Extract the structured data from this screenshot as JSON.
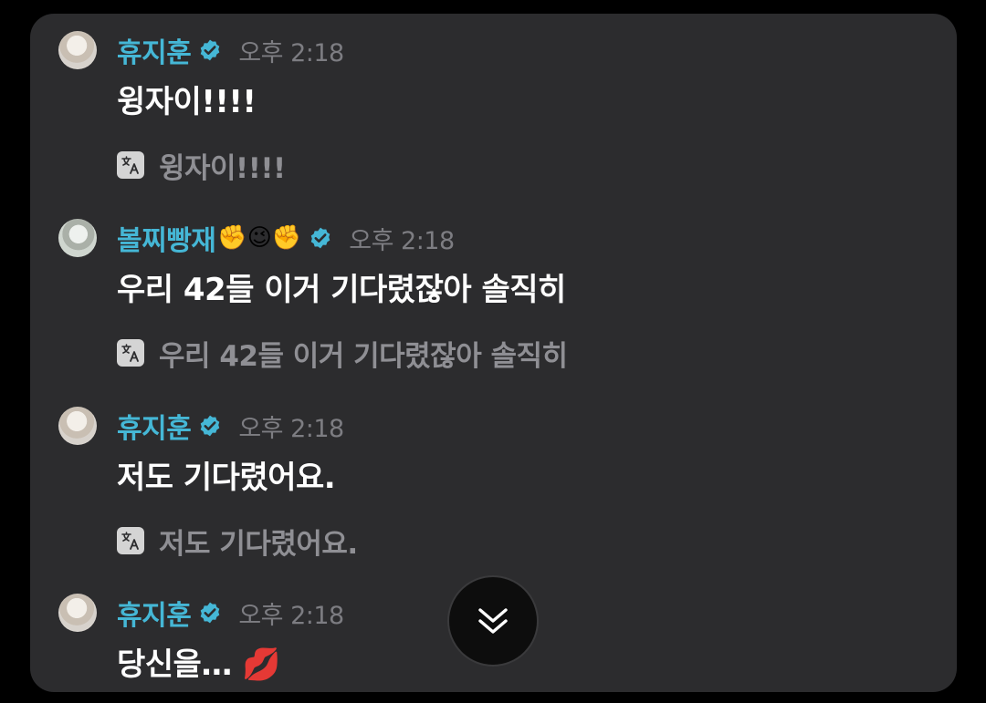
{
  "messages": [
    {
      "author": "휴지훈",
      "author_emojis": "",
      "time": "오후 2:18",
      "text": "윙자이!!!!",
      "translation": "윙자이!!!!"
    },
    {
      "author": "볼찌빵재",
      "author_emojis": "✊😉✊",
      "time": "오후 2:18",
      "text": "우리 42들 이거 기다렸잖아 솔직히",
      "translation": "우리 42들 이거 기다렸잖아 솔직히"
    },
    {
      "author": "휴지훈",
      "author_emojis": "",
      "time": "오후 2:18",
      "text": "저도 기다렸어요.",
      "translation": "저도 기다렸어요."
    },
    {
      "author": "휴지훈",
      "author_emojis": "",
      "time": "오후 2:18",
      "text": "당신을… 💋"
    }
  ],
  "icons": {
    "verified": "verified-badge-icon",
    "translate": "translate-icon",
    "scroll_down": "double-chevron-down-icon"
  },
  "colors": {
    "name": "#45b7d6",
    "verified": "#45b7d6",
    "panel_bg": "#2c2c2e",
    "time": "#7d7d82",
    "translation": "#8f8f94"
  }
}
